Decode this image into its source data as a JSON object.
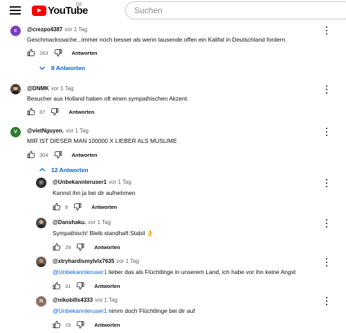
{
  "header": {
    "logo_text": "YouTube",
    "country_code": "DE",
    "search_placeholder": "Suchen"
  },
  "comments": [
    {
      "author": "@crezpo4387",
      "time": "vor 1 Tag",
      "text": "Geschmackssache...immer noch besser als wenn tausende offen ein Kalifat in Deutschland fordern.",
      "likes": "263",
      "reply_label": "Antworten",
      "replies_toggle": "8 Antworten",
      "avatar_letter": "c",
      "avatar_color": "#7b3fbf"
    },
    {
      "author": "@DNMK",
      "time": "vor 1 Tag",
      "text": "Besucher aus Holland haben oft einen sympathischen Akzent.",
      "likes": "87",
      "reply_label": "Antworten",
      "avatar_color": "#5a4a3f"
    },
    {
      "author": "@vietNguyen.",
      "time": "vor 1 Tag",
      "text": "MIR IST DIESER MAN 100000 X LIEBER ALS MUSLIME",
      "likes": "304",
      "reply_label": "Antworten",
      "replies_toggle": "12 Antworten",
      "avatar_letter": "V",
      "avatar_color": "#2e7d32"
    }
  ],
  "replies": [
    {
      "author": "@Unbekannteruser1",
      "time": "vor 1 Tag",
      "text": "Kannst ihn ja bei dir aufnehmen",
      "likes": "8",
      "reply_label": "Antworten",
      "avatar_color": "#2b2b2b"
    },
    {
      "author": "@Danshaku.",
      "time": "vor 1 Tag",
      "text": "Sympathisch! Bleib standhaft Stabil",
      "emoji": "👌",
      "likes": "29",
      "reply_label": "Antworten",
      "avatar_color": "#4a4a4a"
    },
    {
      "author": "@xtryhardismylvlx7635",
      "time": "vor 1 Tag",
      "mention": "@Unbekannteruser1",
      "text": " lieber das als Flüchtlinge in unserem Land, ich habe vor ihn keine Angst",
      "likes": "31",
      "reply_label": "Antworten",
      "avatar_color": "#6d5a4e"
    },
    {
      "author": "@nikobills4333",
      "time": "vor 1 Tag",
      "mention": "@Unbekannteruser1",
      "text": " nimm doch Flüchtlinge bei dir auf",
      "likes": "19",
      "reply_label": "Antworten",
      "avatar_letter": "N",
      "avatar_color": "#8d6e63"
    }
  ]
}
